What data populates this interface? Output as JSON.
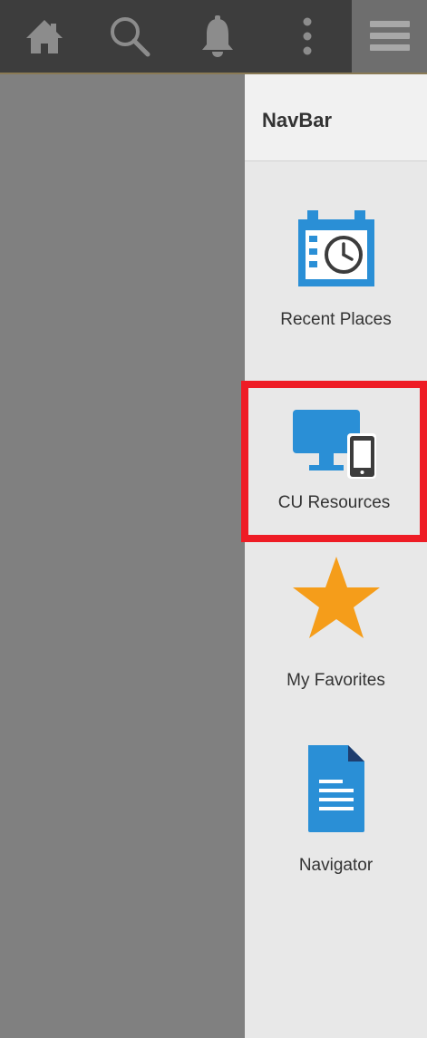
{
  "toolbar": {
    "icons": {
      "home": "home-icon",
      "search": "search-icon",
      "notifications": "bell-icon",
      "actions": "more-vertical-icon",
      "navbar": "hamburger-menu-icon"
    }
  },
  "navbar": {
    "title": "NavBar",
    "items": [
      {
        "label": "Recent Places",
        "icon": "calendar-clock-icon"
      },
      {
        "label": "CU Resources",
        "icon": "devices-icon",
        "highlighted": true
      },
      {
        "label": "My Favorites",
        "icon": "star-icon"
      },
      {
        "label": "Navigator",
        "icon": "document-icon"
      }
    ]
  },
  "colors": {
    "toolbar_bg": "#3d3d3d",
    "toolbar_active_bg": "#6e6e6e",
    "backdrop": "#808080",
    "panel_bg": "#e8e8e8",
    "highlight_border": "#ee1c25",
    "icon_blue": "#2a8fd6",
    "star_orange": "#f59d1a"
  }
}
